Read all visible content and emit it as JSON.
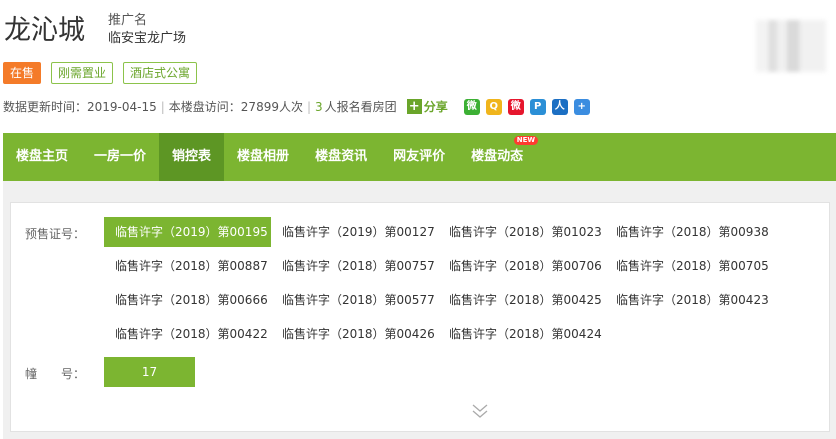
{
  "header": {
    "title": "龙沁城",
    "alias_label": "推广名",
    "alias_value": "临安宝龙广场"
  },
  "tags": [
    {
      "label": "在售",
      "type": "sale"
    },
    {
      "label": "刚需置业",
      "type": "plain"
    },
    {
      "label": "酒店式公寓",
      "type": "plain"
    }
  ],
  "info": {
    "update_text": "数据更新时间：2019-04-15",
    "visits_text": "本楼盘访问：27899人次",
    "signup_count": "3",
    "signup_text": "人报名看房团",
    "share_label": "分享",
    "social_icons": [
      {
        "name": "wechat-icon",
        "color": "#3cb034",
        "glyph": "微"
      },
      {
        "name": "qzone-icon",
        "color": "#f0b51c",
        "glyph": "Q"
      },
      {
        "name": "weibo-icon",
        "color": "#e6162d",
        "glyph": "微"
      },
      {
        "name": "tencent-weibo-icon",
        "color": "#2b8fd6",
        "glyph": "P"
      },
      {
        "name": "renren-icon",
        "color": "#1c6fc3",
        "glyph": "人"
      },
      {
        "name": "more-share-icon",
        "color": "#3b8de0",
        "glyph": "+"
      }
    ]
  },
  "nav": {
    "items": [
      {
        "label": "楼盘主页",
        "active": false
      },
      {
        "label": "一房一价",
        "active": false
      },
      {
        "label": "销控表",
        "active": true
      },
      {
        "label": "楼盘相册",
        "active": false
      },
      {
        "label": "楼盘资讯",
        "active": false
      },
      {
        "label": "网友评价",
        "active": false
      },
      {
        "label": "楼盘动态",
        "active": false,
        "badge": "NEW"
      }
    ]
  },
  "panel": {
    "permit_label": "预售证号：",
    "building_label": "幢　　号：",
    "permits": [
      "临售许字（2019）第00195",
      "临售许字（2019）第00127",
      "临售许字（2018）第01023",
      "临售许字（2018）第00938",
      "临售许字（2018）第00887",
      "临售许字（2018）第00757",
      "临售许字（2018）第00706",
      "临售许字（2018）第00705",
      "临售许字（2018）第00666",
      "临售许字（2018）第00577",
      "临售许字（2018）第00425",
      "临售许字（2018）第00423",
      "临售许字（2018）第00422",
      "临售许字（2018）第00426",
      "临售许字（2018）第00424"
    ],
    "selected_permit_index": 0,
    "building": "17"
  },
  "colors": {
    "brand_green": "#7cb531",
    "nav_active": "#5d9624",
    "sale_orange": "#f47b29"
  }
}
